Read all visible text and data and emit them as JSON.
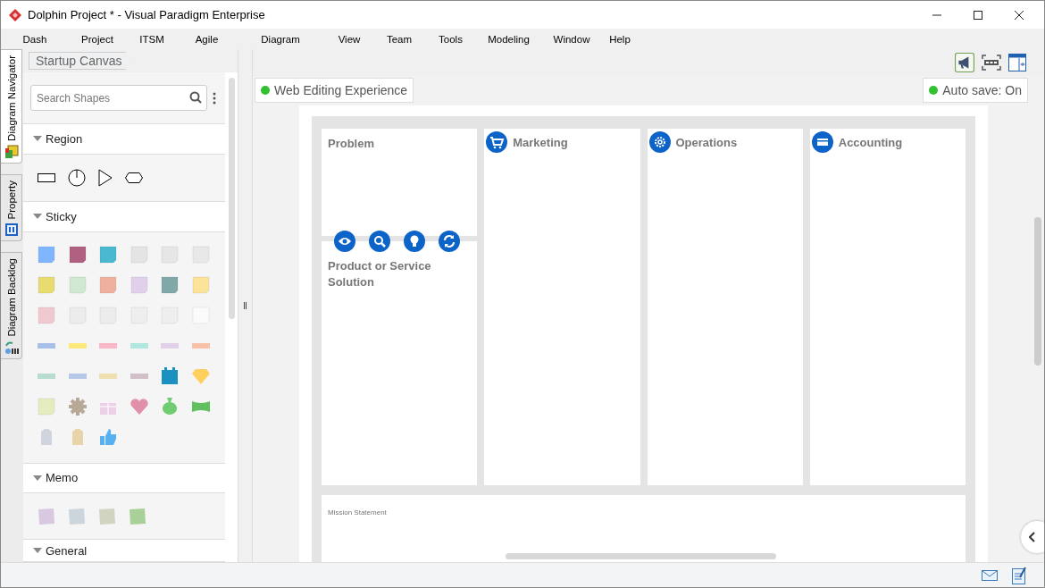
{
  "window": {
    "title": "Dolphin Project * - Visual Paradigm Enterprise"
  },
  "menu": [
    "Dash",
    "Project",
    "ITSM",
    "Agile",
    "Diagram",
    "View",
    "Team",
    "Tools",
    "Modeling",
    "Window",
    "Help"
  ],
  "side_tabs": [
    {
      "label": "Diagram Navigator",
      "selected": true
    },
    {
      "label": "Property",
      "selected": false
    },
    {
      "label": "Diagram Backlog",
      "selected": false
    }
  ],
  "breadcrumb": "Startup Canvas",
  "search": {
    "placeholder": "Search Shapes"
  },
  "palette": [
    {
      "title": "Region"
    },
    {
      "title": "Sticky"
    },
    {
      "title": "Memo"
    },
    {
      "title": "General"
    }
  ],
  "web_editing": {
    "label": "Web Editing Experience",
    "on": true
  },
  "auto_save": {
    "label": "Auto save: On",
    "on": true
  },
  "canvas": {
    "columns": [
      {
        "title": "Problem",
        "lower_title": "Product or Service Solution"
      },
      {
        "title": "Marketing"
      },
      {
        "title": "Operations"
      },
      {
        "title": "Accounting"
      }
    ],
    "mission": "Mission Statement"
  }
}
